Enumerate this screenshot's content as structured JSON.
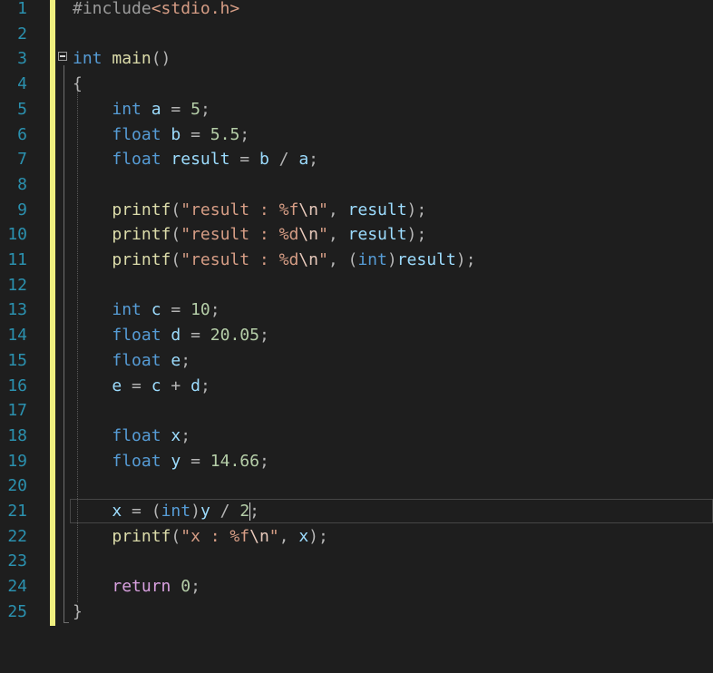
{
  "editor": {
    "language": "C",
    "cursor": {
      "line": 21,
      "column": 20
    },
    "colors": {
      "background": "#1e1e1e",
      "line_number": "#2b91af",
      "change_marker": "#efef7f",
      "keyword": "#569cd6",
      "control_keyword": "#d8a0df",
      "function": "#dcdcaa",
      "variable": "#9cdcfe",
      "number": "#b5cea8",
      "string": "#d69d85",
      "preprocessor": "#9b9b9b"
    },
    "line_numbers": [
      "1",
      "2",
      "3",
      "4",
      "5",
      "6",
      "7",
      "8",
      "9",
      "10",
      "11",
      "12",
      "13",
      "14",
      "15",
      "16",
      "17",
      "18",
      "19",
      "20",
      "21",
      "22",
      "23",
      "24",
      "25"
    ],
    "lines": [
      {
        "n": 1,
        "tokens": [
          [
            "pp",
            "#include"
          ],
          [
            "inc",
            "<stdio.h>"
          ]
        ]
      },
      {
        "n": 2,
        "tokens": []
      },
      {
        "n": 3,
        "tokens": [
          [
            "kw",
            "int"
          ],
          [
            "p",
            " "
          ],
          [
            "fn",
            "main"
          ],
          [
            "punc",
            "()"
          ]
        ]
      },
      {
        "n": 4,
        "tokens": [
          [
            "punc",
            "{"
          ]
        ]
      },
      {
        "n": 5,
        "tokens": [
          [
            "p",
            "    "
          ],
          [
            "kw",
            "int"
          ],
          [
            "p",
            " "
          ],
          [
            "var",
            "a"
          ],
          [
            "p",
            " "
          ],
          [
            "op",
            "="
          ],
          [
            "p",
            " "
          ],
          [
            "num",
            "5"
          ],
          [
            "punc",
            ";"
          ]
        ]
      },
      {
        "n": 6,
        "tokens": [
          [
            "p",
            "    "
          ],
          [
            "kw",
            "float"
          ],
          [
            "p",
            " "
          ],
          [
            "var",
            "b"
          ],
          [
            "p",
            " "
          ],
          [
            "op",
            "="
          ],
          [
            "p",
            " "
          ],
          [
            "num",
            "5.5"
          ],
          [
            "punc",
            ";"
          ]
        ]
      },
      {
        "n": 7,
        "tokens": [
          [
            "p",
            "    "
          ],
          [
            "kw",
            "float"
          ],
          [
            "p",
            " "
          ],
          [
            "var",
            "result"
          ],
          [
            "p",
            " "
          ],
          [
            "op",
            "="
          ],
          [
            "p",
            " "
          ],
          [
            "var",
            "b"
          ],
          [
            "p",
            " "
          ],
          [
            "op",
            "/"
          ],
          [
            "p",
            " "
          ],
          [
            "var",
            "a"
          ],
          [
            "punc",
            ";"
          ]
        ]
      },
      {
        "n": 8,
        "tokens": []
      },
      {
        "n": 9,
        "tokens": [
          [
            "p",
            "    "
          ],
          [
            "fn",
            "printf"
          ],
          [
            "punc",
            "("
          ],
          [
            "str",
            "\"result : "
          ],
          [
            "fmt",
            "%f"
          ],
          [
            "esc",
            "\\n"
          ],
          [
            "str",
            "\""
          ],
          [
            "punc",
            ", "
          ],
          [
            "var",
            "result"
          ],
          [
            "punc",
            ");"
          ]
        ]
      },
      {
        "n": 10,
        "tokens": [
          [
            "p",
            "    "
          ],
          [
            "fn",
            "printf"
          ],
          [
            "punc",
            "("
          ],
          [
            "str",
            "\"result : "
          ],
          [
            "fmt",
            "%d"
          ],
          [
            "esc",
            "\\n"
          ],
          [
            "str",
            "\""
          ],
          [
            "punc",
            ", "
          ],
          [
            "var",
            "result"
          ],
          [
            "punc",
            ");"
          ]
        ]
      },
      {
        "n": 11,
        "tokens": [
          [
            "p",
            "    "
          ],
          [
            "fn",
            "printf"
          ],
          [
            "punc",
            "("
          ],
          [
            "str",
            "\"result : "
          ],
          [
            "fmt",
            "%d"
          ],
          [
            "esc",
            "\\n"
          ],
          [
            "str",
            "\""
          ],
          [
            "punc",
            ", ("
          ],
          [
            "kw",
            "int"
          ],
          [
            "punc",
            ")"
          ],
          [
            "var",
            "result"
          ],
          [
            "punc",
            ");"
          ]
        ]
      },
      {
        "n": 12,
        "tokens": []
      },
      {
        "n": 13,
        "tokens": [
          [
            "p",
            "    "
          ],
          [
            "kw",
            "int"
          ],
          [
            "p",
            " "
          ],
          [
            "var",
            "c"
          ],
          [
            "p",
            " "
          ],
          [
            "op",
            "="
          ],
          [
            "p",
            " "
          ],
          [
            "num",
            "10"
          ],
          [
            "punc",
            ";"
          ]
        ]
      },
      {
        "n": 14,
        "tokens": [
          [
            "p",
            "    "
          ],
          [
            "kw",
            "float"
          ],
          [
            "p",
            " "
          ],
          [
            "var",
            "d"
          ],
          [
            "p",
            " "
          ],
          [
            "op",
            "="
          ],
          [
            "p",
            " "
          ],
          [
            "num",
            "20.05"
          ],
          [
            "punc",
            ";"
          ]
        ]
      },
      {
        "n": 15,
        "tokens": [
          [
            "p",
            "    "
          ],
          [
            "kw",
            "float"
          ],
          [
            "p",
            " "
          ],
          [
            "var",
            "e"
          ],
          [
            "punc",
            ";"
          ]
        ]
      },
      {
        "n": 16,
        "tokens": [
          [
            "p",
            "    "
          ],
          [
            "var",
            "e"
          ],
          [
            "p",
            " "
          ],
          [
            "op",
            "="
          ],
          [
            "p",
            " "
          ],
          [
            "var",
            "c"
          ],
          [
            "p",
            " "
          ],
          [
            "op",
            "+"
          ],
          [
            "p",
            " "
          ],
          [
            "var",
            "d"
          ],
          [
            "punc",
            ";"
          ]
        ]
      },
      {
        "n": 17,
        "tokens": []
      },
      {
        "n": 18,
        "tokens": [
          [
            "p",
            "    "
          ],
          [
            "kw",
            "float"
          ],
          [
            "p",
            " "
          ],
          [
            "var",
            "x"
          ],
          [
            "punc",
            ";"
          ]
        ]
      },
      {
        "n": 19,
        "tokens": [
          [
            "p",
            "    "
          ],
          [
            "kw",
            "float"
          ],
          [
            "p",
            " "
          ],
          [
            "var",
            "y"
          ],
          [
            "p",
            " "
          ],
          [
            "op",
            "="
          ],
          [
            "p",
            " "
          ],
          [
            "num",
            "14.66"
          ],
          [
            "punc",
            ";"
          ]
        ]
      },
      {
        "n": 20,
        "tokens": []
      },
      {
        "n": 21,
        "tokens": [
          [
            "p",
            "    "
          ],
          [
            "var",
            "x"
          ],
          [
            "p",
            " "
          ],
          [
            "op",
            "="
          ],
          [
            "p",
            " "
          ],
          [
            "punc",
            "("
          ],
          [
            "kw",
            "int"
          ],
          [
            "punc",
            ")"
          ],
          [
            "var",
            "y"
          ],
          [
            "p",
            " "
          ],
          [
            "op",
            "/"
          ],
          [
            "p",
            " "
          ],
          [
            "num",
            "2"
          ],
          [
            "caret",
            ""
          ],
          [
            "punc",
            ";"
          ]
        ]
      },
      {
        "n": 22,
        "tokens": [
          [
            "p",
            "    "
          ],
          [
            "fn",
            "printf"
          ],
          [
            "punc",
            "("
          ],
          [
            "str",
            "\"x : "
          ],
          [
            "fmt",
            "%f"
          ],
          [
            "esc",
            "\\n"
          ],
          [
            "str",
            "\""
          ],
          [
            "punc",
            ", "
          ],
          [
            "var",
            "x"
          ],
          [
            "punc",
            ");"
          ]
        ]
      },
      {
        "n": 23,
        "tokens": []
      },
      {
        "n": 24,
        "tokens": [
          [
            "p",
            "    "
          ],
          [
            "ret",
            "return"
          ],
          [
            "p",
            " "
          ],
          [
            "num",
            "0"
          ],
          [
            "punc",
            ";"
          ]
        ]
      },
      {
        "n": 25,
        "tokens": [
          [
            "punc",
            "}"
          ]
        ]
      }
    ]
  }
}
